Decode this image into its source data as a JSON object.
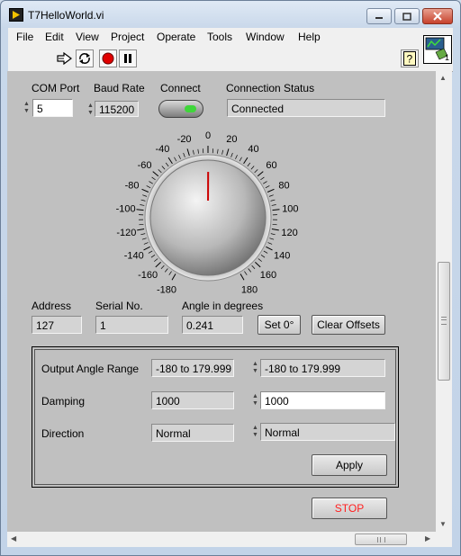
{
  "window": {
    "title": "T7HelloWorld.vi"
  },
  "menu": [
    "File",
    "Edit",
    "View",
    "Project",
    "Operate",
    "Tools",
    "Window",
    "Help"
  ],
  "connection": {
    "com_port_label": "COM Port",
    "com_port_value": "5",
    "baud_rate_label": "Baud Rate",
    "baud_rate_value": "115200",
    "connect_label": "Connect",
    "status_label": "Connection Status",
    "status_value": "Connected",
    "led_color": "#3fd63a"
  },
  "knob": {
    "value_degrees": 0.241,
    "scale_min": -180,
    "scale_max": 180,
    "tick_labels": [
      "-180",
      "-160",
      "-140",
      "-120",
      "-100",
      "-80",
      "-60",
      "-40",
      "-20",
      "0",
      "20",
      "40",
      "60",
      "80",
      "100",
      "120",
      "140",
      "160",
      "180"
    ],
    "needle_color": "#cc0000"
  },
  "readout": {
    "address_label": "Address",
    "address_value": "127",
    "serial_label": "Serial No.",
    "serial_value": "1",
    "angle_label": "Angle in degrees",
    "angle_value": "0.241",
    "set0_button": "Set 0°",
    "clear_offsets_button": "Clear Offsets"
  },
  "settings": {
    "output_range_label": "Output Angle Range",
    "output_range_current": "-180 to 179.999",
    "output_range_new": "-180 to 179.999",
    "damping_label": "Damping",
    "damping_current": "1000",
    "damping_new": "1000",
    "direction_label": "Direction",
    "direction_current": "Normal",
    "direction_new": "Normal",
    "apply_button": "Apply"
  },
  "stop_button": {
    "label": "STOP",
    "color": "#ff2020"
  },
  "connector_pane": {
    "number": "1"
  }
}
